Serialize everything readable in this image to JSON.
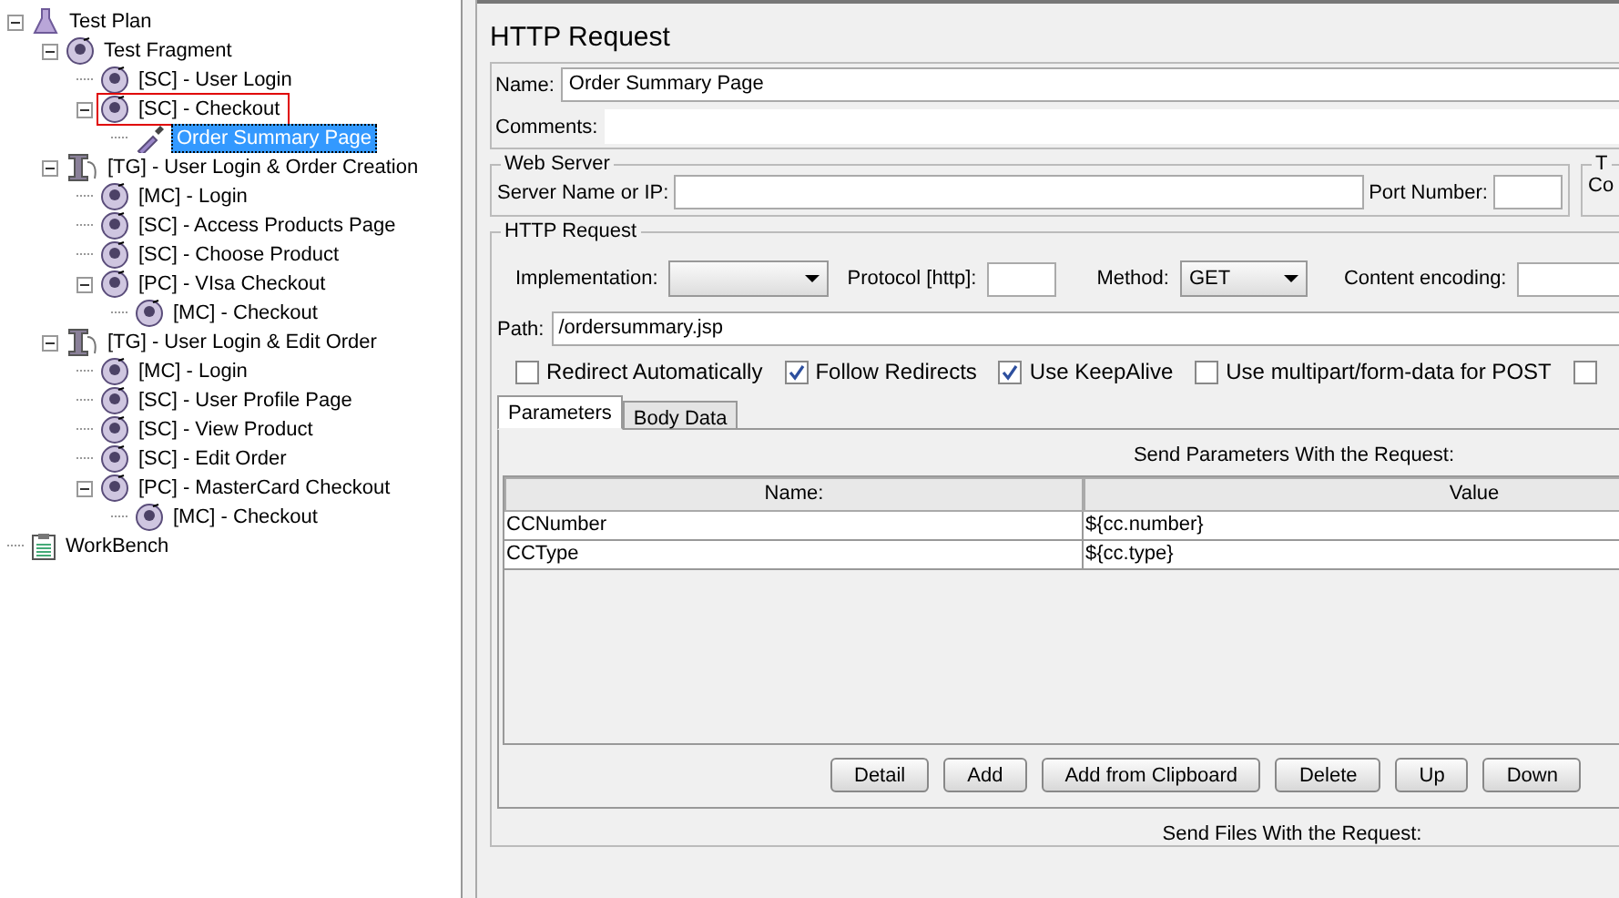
{
  "tree": [
    {
      "label": "Test Plan",
      "kind": "plan",
      "expanded": true,
      "selected": false,
      "outlined": false,
      "children": [
        {
          "label": "Test Fragment",
          "kind": "controller",
          "expanded": true,
          "selected": false,
          "outlined": false,
          "children": [
            {
              "label": "[SC] - User Login",
              "kind": "controller",
              "selected": false,
              "outlined": false
            },
            {
              "label": "[SC] - Checkout",
              "kind": "controller",
              "expanded": true,
              "selected": false,
              "outlined": true,
              "children": [
                {
                  "label": "Order Summary Page",
                  "kind": "sampler",
                  "selected": true,
                  "outlined": false
                }
              ]
            }
          ]
        },
        {
          "label": "[TG] - User Login & Order Creation",
          "kind": "threadgroup",
          "expanded": true,
          "selected": false,
          "outlined": false,
          "children": [
            {
              "label": "[MC] - Login",
              "kind": "controller",
              "selected": false,
              "outlined": false
            },
            {
              "label": "[SC] - Access Products Page",
              "kind": "controller",
              "selected": false,
              "outlined": false
            },
            {
              "label": "[SC] - Choose Product",
              "kind": "controller",
              "selected": false,
              "outlined": false
            },
            {
              "label": "[PC] - VIsa Checkout",
              "kind": "controller",
              "expanded": true,
              "selected": false,
              "outlined": false,
              "children": [
                {
                  "label": "[MC] - Checkout",
                  "kind": "controller",
                  "selected": false,
                  "outlined": false
                }
              ]
            }
          ]
        },
        {
          "label": "[TG] - User Login & Edit Order",
          "kind": "threadgroup",
          "expanded": true,
          "selected": false,
          "outlined": false,
          "children": [
            {
              "label": "[MC] - Login",
              "kind": "controller",
              "selected": false,
              "outlined": false
            },
            {
              "label": "[SC] - User Profile Page",
              "kind": "controller",
              "selected": false,
              "outlined": false
            },
            {
              "label": "[SC] - View Product",
              "kind": "controller",
              "selected": false,
              "outlined": false
            },
            {
              "label": "[SC] - Edit Order",
              "kind": "controller",
              "selected": false,
              "outlined": false
            },
            {
              "label": "[PC] - MasterCard Checkout",
              "kind": "controller",
              "expanded": true,
              "selected": false,
              "outlined": false,
              "children": [
                {
                  "label": "[MC] - Checkout",
                  "kind": "controller",
                  "selected": false,
                  "outlined": false
                }
              ]
            }
          ]
        }
      ]
    },
    {
      "label": "WorkBench",
      "kind": "workbench",
      "selected": false,
      "outlined": false
    }
  ],
  "editor": {
    "title": "HTTP Request",
    "name": {
      "label": "Name:",
      "value": "Order Summary Page"
    },
    "comments": {
      "label": "Comments:"
    },
    "web_server": {
      "title": "Web Server",
      "server_label": "Server Name or IP:",
      "port_label": "Port Number:"
    },
    "group_2": {
      "title": "T",
      "label": "Co"
    },
    "http_request": {
      "title": "HTTP Request",
      "implementation_label": "Implementation:",
      "protocol_label": "Protocol [http]:",
      "method_label": "Method:",
      "method_value": "GET",
      "encoding_label": "Content encoding:",
      "path_label": "Path:",
      "path_value": "/ordersummary.jsp",
      "options": [
        {
          "label": "Redirect Automatically",
          "checked": false
        },
        {
          "label": "Follow Redirects",
          "checked": true
        },
        {
          "label": "Use KeepAlive",
          "checked": true
        },
        {
          "label": "Use multipart/form-data for POST",
          "checked": false
        },
        {
          "checked": false
        }
      ]
    },
    "tabs": [
      {
        "label": "Parameters",
        "selected": true
      },
      {
        "label": "Body Data",
        "selected": false
      }
    ],
    "parameters": {
      "title": "Send Parameters With the Request:",
      "columns": [
        "Name:",
        "Value"
      ],
      "rows": [
        [
          "CCNumber",
          "${cc.number}"
        ],
        [
          "CCType",
          "${cc.type}"
        ]
      ],
      "buttons": [
        "Detail",
        "Add",
        "Add from Clipboard",
        "Delete",
        "Up",
        "Down"
      ]
    },
    "files": {
      "title": "Send Files With the Request:"
    }
  }
}
